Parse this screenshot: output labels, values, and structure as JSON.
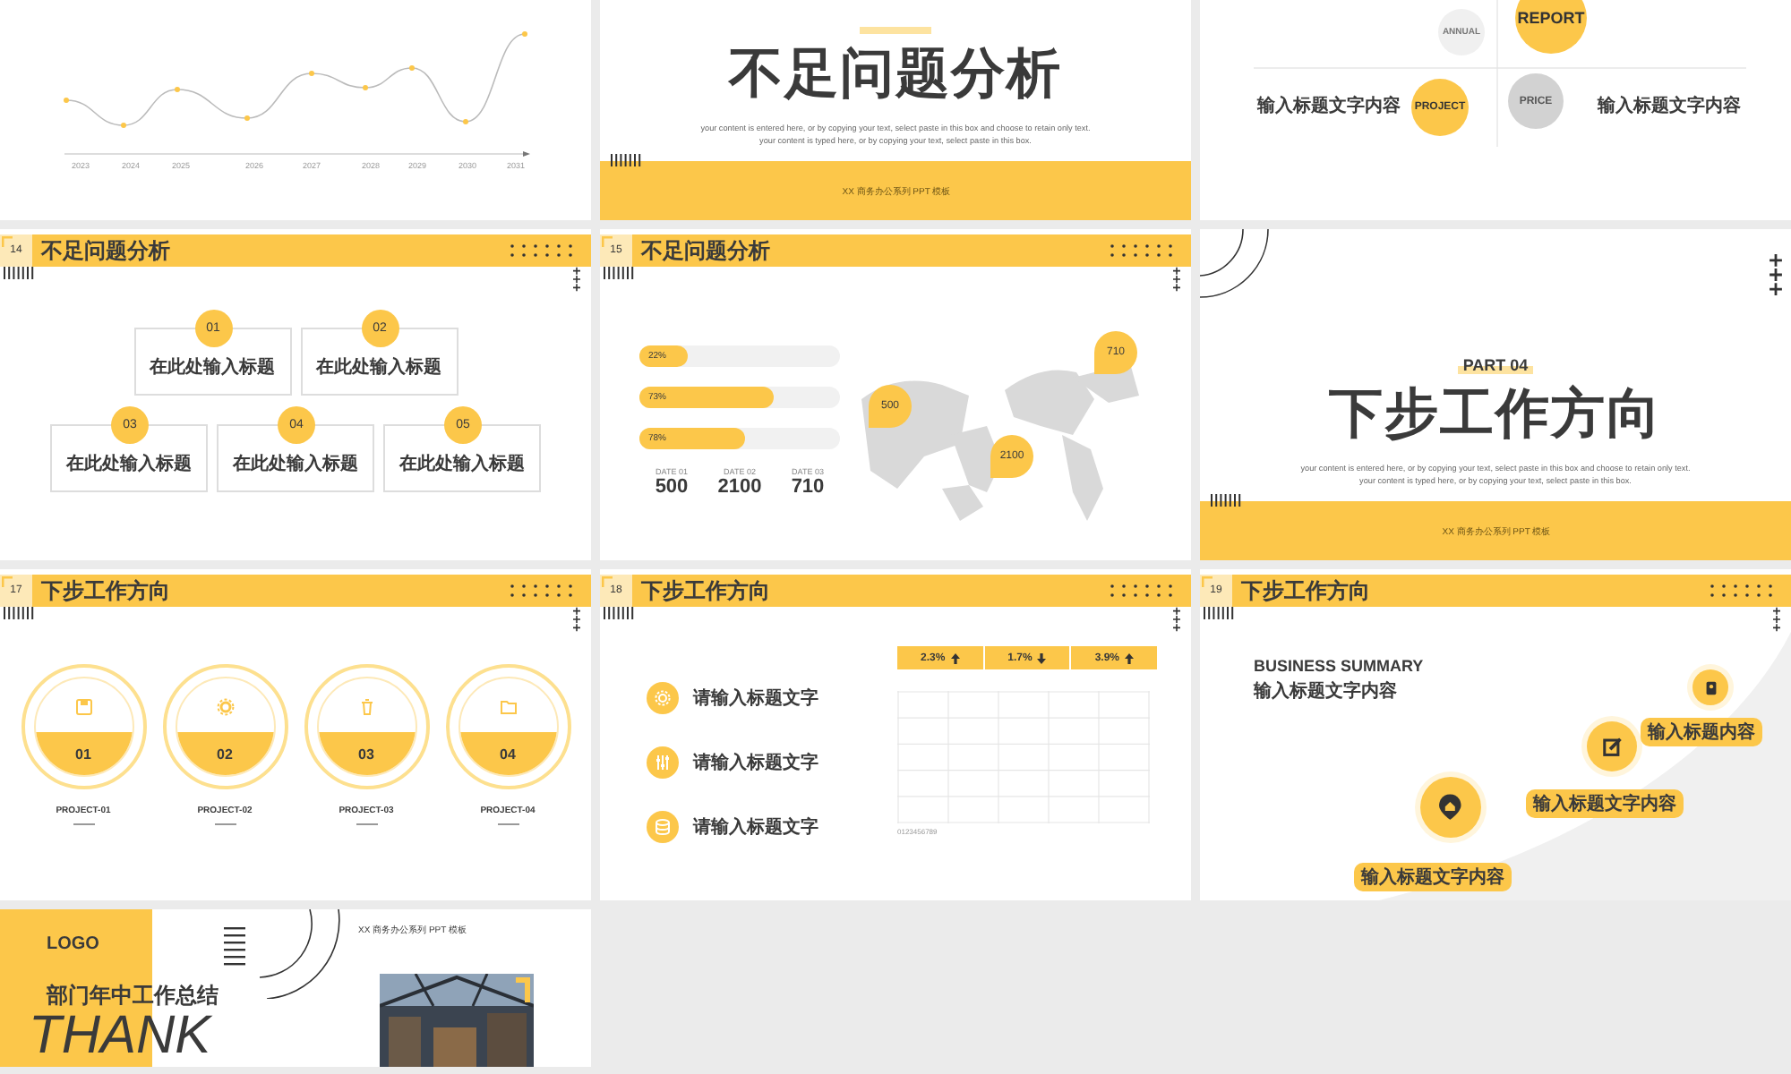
{
  "slides": [
    {
      "kind": "timeline",
      "years": [
        "2023",
        "2024",
        "2025",
        "2026",
        "2027",
        "2028",
        "2029",
        "2030",
        "2031"
      ]
    },
    {
      "kind": "section",
      "title": "不足问题分析",
      "subtitle": [
        "your content is entered here, or by copying your text, select paste in this box and choose to retain only text.",
        "your content is typed here, or by copying your text, select paste in this box."
      ],
      "footer": "XX 商务办公系列 PPT 模板"
    },
    {
      "kind": "quadrant",
      "circles": [
        {
          "label": "ANNUAL",
          "highlighted": false
        },
        {
          "label": "REPORT",
          "highlighted": true
        },
        {
          "label": "PROJECT",
          "highlighted": true
        },
        {
          "label": "PRICE",
          "highlighted": false
        }
      ],
      "headings": [
        "输入标题文字内容",
        "输入标题文字内容"
      ]
    },
    {
      "kind": "cards",
      "number": "14",
      "title": "不足问题分析",
      "cards": [
        {
          "badge": "01",
          "title": "在此处输入标题"
        },
        {
          "badge": "02",
          "title": "在此处输入标题"
        },
        {
          "badge": "03",
          "title": "在此处输入标题"
        },
        {
          "badge": "04",
          "title": "在此处输入标题"
        },
        {
          "badge": "05",
          "title": "在此处输入标题"
        }
      ]
    },
    {
      "kind": "map",
      "number": "15",
      "title": "不足问题分析",
      "bars": [
        {
          "label": "22%",
          "level": 0.24
        },
        {
          "label": "73%",
          "level": 0.67
        },
        {
          "label": "78%",
          "level": 0.53
        }
      ],
      "stats": [
        {
          "label": "DATE 01",
          "value": "500"
        },
        {
          "label": "DATE 02",
          "value": "2100"
        },
        {
          "label": "DATE 03",
          "value": "710"
        }
      ],
      "pins": [
        "500",
        "2100",
        "710"
      ]
    },
    {
      "kind": "section",
      "part": "PART 04",
      "title": "下步工作方向",
      "subtitle": [
        "your content is entered here, or by copying your text, select paste in this box and choose to retain only text.",
        "your content is typed here, or by copying your text, select paste in this box."
      ],
      "footer": "XX 商务办公系列 PPT 模板"
    },
    {
      "kind": "projects",
      "number": "17",
      "title": "下步工作方向",
      "items": [
        {
          "number": "01",
          "name": "PROJECT-01"
        },
        {
          "number": "02",
          "name": "PROJECT-02"
        },
        {
          "number": "03",
          "name": "PROJECT-03"
        },
        {
          "number": "04",
          "name": "PROJECT-04"
        }
      ]
    },
    {
      "kind": "list",
      "number": "18",
      "title": "下步工作方向",
      "items": [
        "请输入标题文字",
        "请输入标题文字",
        "请输入标题文字"
      ],
      "stats": [
        {
          "value": "2.3%",
          "rising": true
        },
        {
          "value": "1.7%",
          "rising": false
        },
        {
          "value": "3.9%",
          "rising": true
        }
      ],
      "note": "0123456789"
    },
    {
      "kind": "summary",
      "number": "19",
      "title": "下步工作方向",
      "heading": "BUSINESS SUMMARY",
      "subheading": "输入标题文字内容",
      "labels": [
        "输入标题内容",
        "输入标题文字内容",
        "输入标题文字内容"
      ]
    },
    {
      "kind": "closing",
      "logo": "LOGO",
      "subtitle": "部门年中工作总结",
      "title": "THANK",
      "footer": "XX 商务办公系列 PPT 模板"
    }
  ]
}
